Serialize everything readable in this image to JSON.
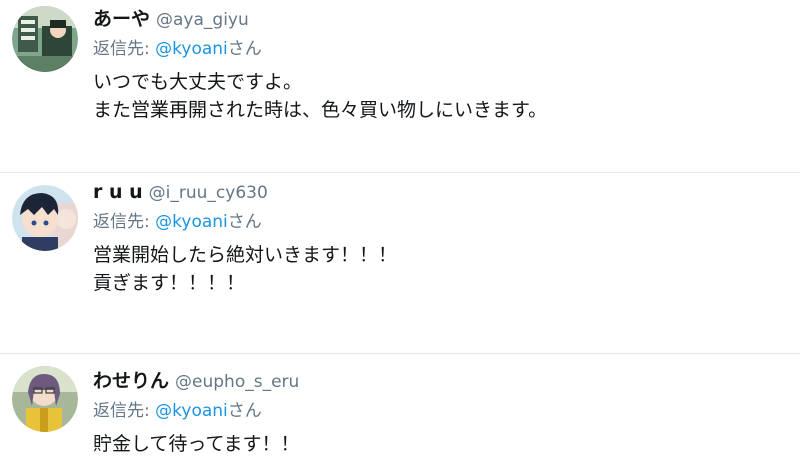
{
  "replies": [
    {
      "display_name": "あーや",
      "handle": "@aya_giyu",
      "replying_prefix": "返信先: ",
      "replying_mention": "@kyoani",
      "replying_suffix": "さん",
      "text_lines": [
        "いつでも大丈夫ですよ。",
        "また営業再開された時は、色々買い物しにいきます。"
      ]
    },
    {
      "display_name": "r u u",
      "handle": "@i_ruu_cy630",
      "replying_prefix": "返信先: ",
      "replying_mention": "@kyoani",
      "replying_suffix": "さん",
      "text_lines": [
        "営業開始したら絶対いきます！！！",
        "貢ぎます！！！！"
      ]
    },
    {
      "display_name": "わせりん",
      "handle": "@eupho_s_eru",
      "replying_prefix": "返信先: ",
      "replying_mention": "@kyoani",
      "replying_suffix": "さん",
      "text_lines": [
        "貯金して待ってます！！"
      ]
    }
  ],
  "colors": {
    "name": "#14171a",
    "handle": "#657786",
    "mention": "#1b95e0",
    "divider": "#e1e8ed"
  }
}
